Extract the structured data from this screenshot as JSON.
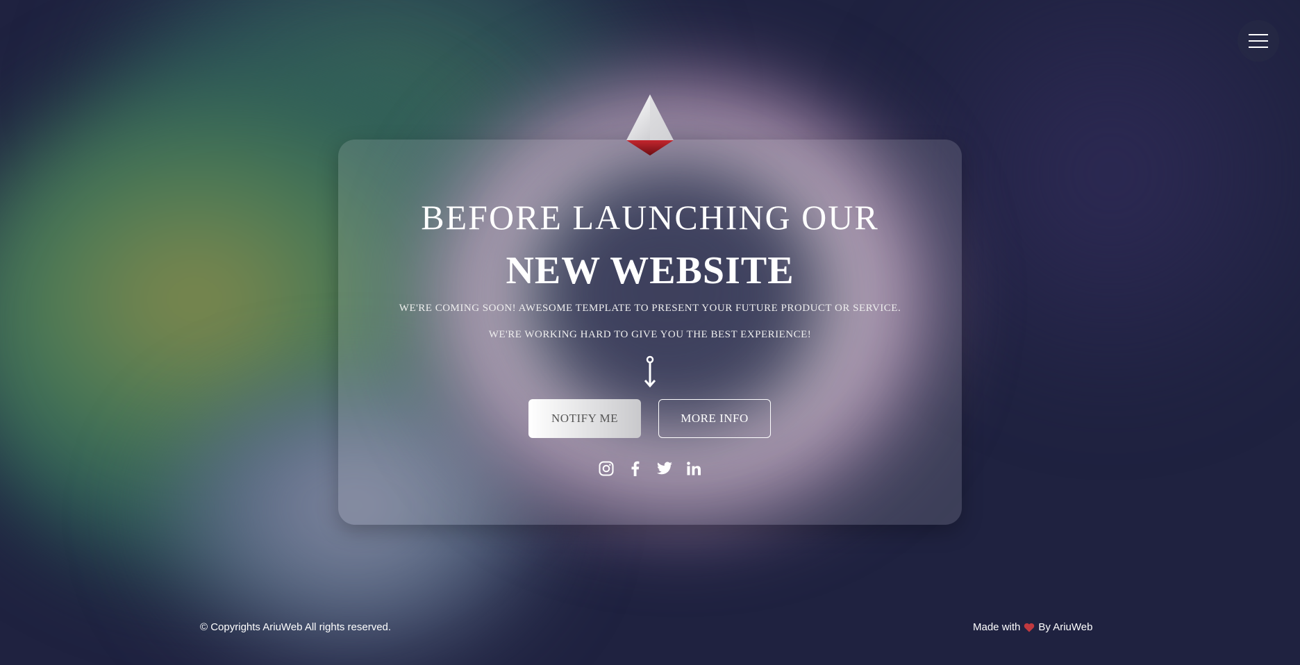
{
  "header": {
    "menu_icon": "hamburger-menu-icon"
  },
  "hero": {
    "logo_icon": "pyramid-logo-icon",
    "title_line1": "BEFORE LAUNCHING OUR",
    "title_line2": "NEW WEBSITE",
    "subtitle_line1": "WE'RE COMING SOON! AWESOME TEMPLATE TO PRESENT YOUR FUTURE PRODUCT OR SERVICE.",
    "subtitle_line2": "WE'RE WORKING HARD TO GIVE YOU THE BEST EXPERIENCE!",
    "scroll_icon": "scroll-down-arrow-icon",
    "buttons": {
      "notify_label": "NOTIFY ME",
      "more_info_label": "MORE INFO"
    },
    "social": [
      {
        "icon": "instagram-icon"
      },
      {
        "icon": "facebook-icon"
      },
      {
        "icon": "twitter-icon"
      },
      {
        "icon": "linkedin-icon"
      }
    ]
  },
  "footer": {
    "copyright": "© Copyrights AriuWeb All rights reserved.",
    "made_with": "Made with",
    "heart_icon": "heart-icon",
    "by": "By AriuWeb"
  },
  "colors": {
    "background": "#1f2240",
    "accent_red": "#b3262e",
    "text": "#ffffff"
  }
}
